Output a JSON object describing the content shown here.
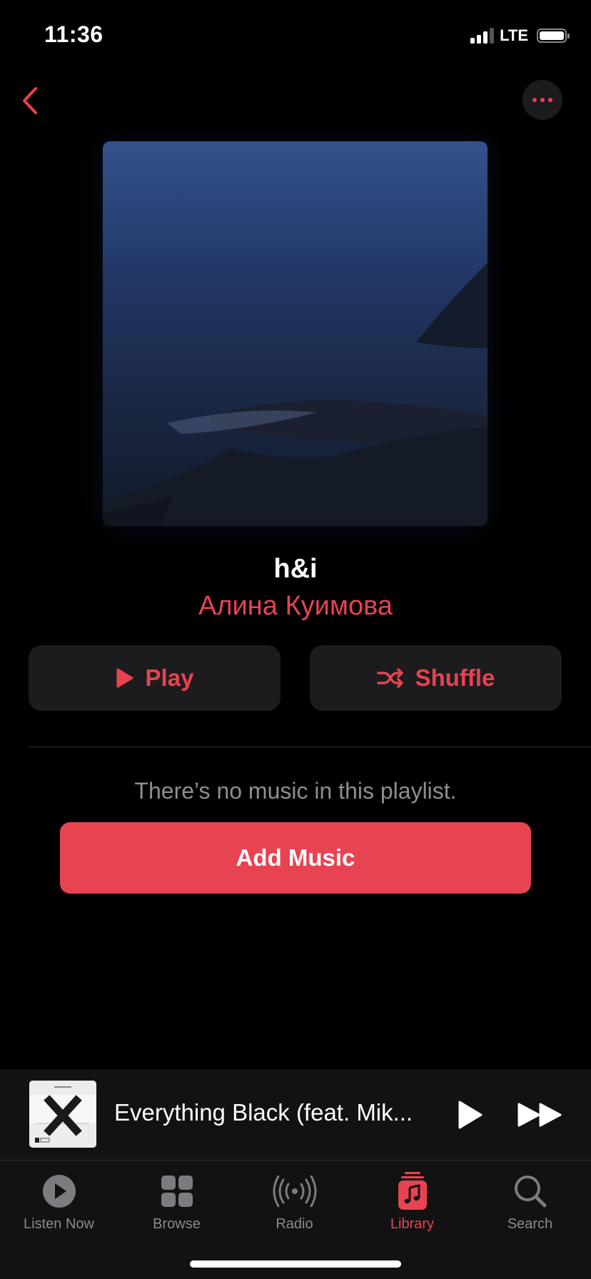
{
  "status_bar": {
    "time": "11:36",
    "network": "LTE",
    "signal_bars_active": 3,
    "signal_bars_total": 4,
    "battery_icon": "battery-icon"
  },
  "nav": {
    "back_icon": "chevron-left-icon",
    "more_icon": "ellipsis-icon"
  },
  "playlist": {
    "title": "h&i",
    "artist": "Алина  Куимова",
    "artwork": "artwork-dark-coastline"
  },
  "actions": {
    "play_label": "Play",
    "play_icon": "play-icon",
    "shuffle_label": "Shuffle",
    "shuffle_icon": "shuffle-icon"
  },
  "empty_state": {
    "message": "There’s no music in this playlist.",
    "add_music_label": "Add Music"
  },
  "mini_player": {
    "track_title": "Everything Black (feat. Mik...",
    "play_icon": "play-icon",
    "next_icon": "forward-icon"
  },
  "tab_bar": {
    "items": [
      {
        "label": "Listen Now",
        "icon": "listen-now-icon",
        "active": false
      },
      {
        "label": "Browse",
        "icon": "browse-grid-icon",
        "active": false
      },
      {
        "label": "Radio",
        "icon": "radio-icon",
        "active": false
      },
      {
        "label": "Library",
        "icon": "library-icon",
        "active": true
      },
      {
        "label": "Search",
        "icon": "search-icon",
        "active": false
      }
    ]
  },
  "colors": {
    "accent": "#e84351",
    "background": "#000000",
    "button_bg": "#1c1c1e",
    "secondary_text": "#8e8e93",
    "tab_inactive": "#8a8a8e"
  }
}
